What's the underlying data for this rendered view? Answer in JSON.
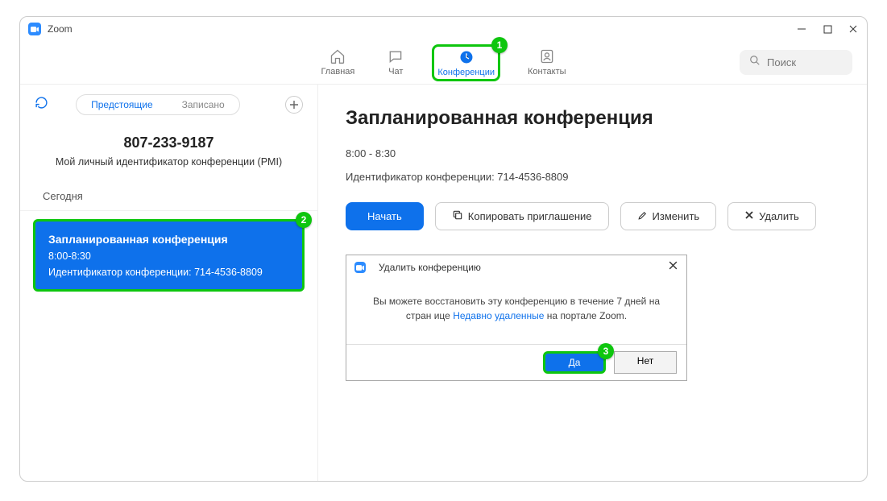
{
  "window": {
    "title": "Zoom"
  },
  "nav": {
    "home": "Главная",
    "chat": "Чат",
    "meetings": "Конференции",
    "contacts": "Контакты"
  },
  "search": {
    "placeholder": "Поиск"
  },
  "sidebar": {
    "tabs": {
      "upcoming": "Предстоящие",
      "recorded": "Записано"
    },
    "pmi": {
      "number": "807-233-9187",
      "label": "Мой личный идентификатор конференции (PMI)"
    },
    "today_label": "Сегодня",
    "selected": {
      "title": "Запланированная конференция",
      "time": "8:00-8:30",
      "id_line": "Идентификатор конференции: 714-4536-8809"
    }
  },
  "detail": {
    "title": "Запланированная конференция",
    "time": "8:00 - 8:30",
    "id_line": "Идентификатор конференции: 714-4536-8809",
    "start": "Начать",
    "copy": "Копировать приглашение",
    "edit": "Изменить",
    "delete": "Удалить"
  },
  "dialog": {
    "title": "Удалить конференцию",
    "body_pre": "Вы можете восстановить эту конференцию в течение 7 дней на стран ице ",
    "link": "Недавно удаленные",
    "body_post": " на портале Zoom.",
    "yes": "Да",
    "no": "Нет"
  },
  "badges": {
    "one": "1",
    "two": "2",
    "three": "3"
  }
}
